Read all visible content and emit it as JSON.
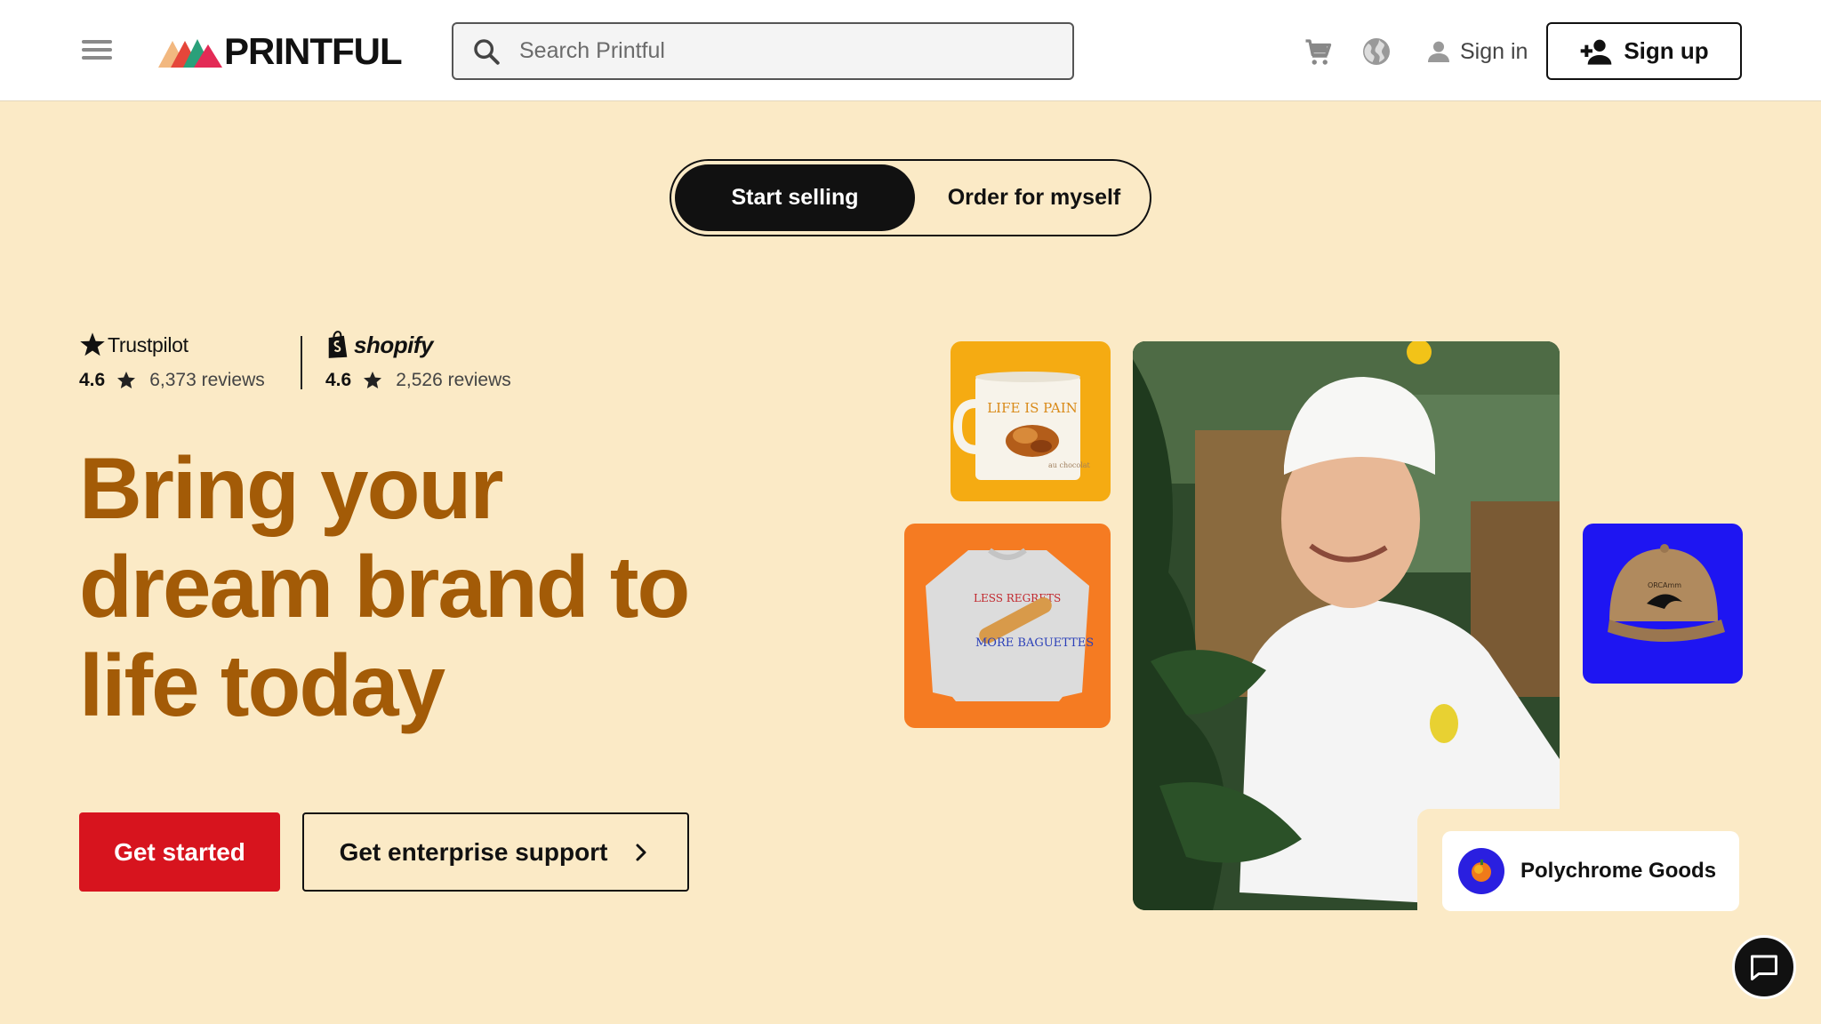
{
  "header": {
    "logo_text": "PRINTFUL",
    "search": {
      "placeholder": "Search Printful"
    },
    "signin_label": "Sign in",
    "signup_label": "Sign up",
    "icons": [
      "menu-icon",
      "search-icon",
      "cart-icon",
      "globe-icon",
      "user-icon",
      "add-user-icon"
    ]
  },
  "toggle": {
    "active_label": "Start selling",
    "inactive_label": "Order for myself"
  },
  "ratings": [
    {
      "brand": "Trustpilot",
      "score": "4.6",
      "reviews": "6,373 reviews"
    },
    {
      "brand": "shopify",
      "score": "4.6",
      "reviews": "2,526 reviews"
    }
  ],
  "hero": {
    "headline_lines": [
      "Bring your",
      "dream brand to",
      "life today"
    ],
    "primary_cta": "Get started",
    "secondary_cta": "Get enterprise support"
  },
  "images": {
    "mug_text": "LIFE IS PAIN",
    "mug_subtext": "au chocolat",
    "sweatshirt_text_top": "LESS REGRETS",
    "sweatshirt_text_bottom": "MORE BAGUETTES",
    "cap_text": "ORCAmm"
  },
  "store_badge": {
    "name": "Polychrome Goods"
  },
  "colors": {
    "background": "#fbeac6",
    "headline": "#a35b07",
    "primary_button": "#d7141e",
    "mug_tile": "#f5ab12",
    "sweat_tile": "#f57b22",
    "cap_tile": "#1e15f2"
  }
}
